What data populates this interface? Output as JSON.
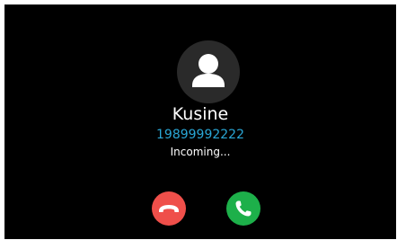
{
  "caller": {
    "name": "Kusine",
    "number": "19899992222",
    "status": "Incoming...",
    "avatar_icon": "person-icon"
  },
  "actions": {
    "decline_icon": "phone-hangup-icon",
    "accept_icon": "phone-icon"
  },
  "colors": {
    "background": "#000000",
    "avatar_bg": "#2a2a2a",
    "number": "#2aa7d6",
    "decline": "#ef4f4a",
    "accept": "#1db04a"
  }
}
